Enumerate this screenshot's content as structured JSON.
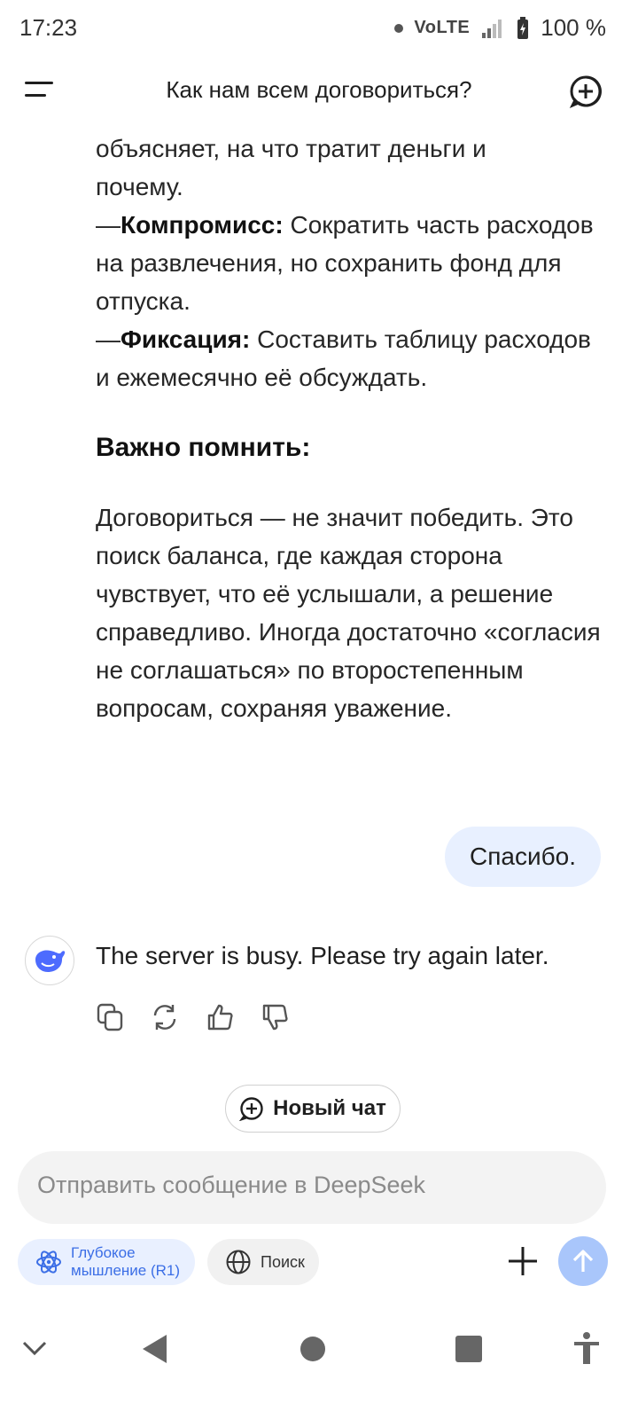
{
  "status_bar": {
    "time": "17:23",
    "network": "VoLTE",
    "battery": "100 %"
  },
  "header": {
    "title": "Как нам всем договориться?"
  },
  "answer": {
    "line1": "объясняет, на что тратит деньги и",
    "line2": "почему.",
    "item_compromise_label": "Компромисс:",
    "item_compromise_text": " Сократить часть расходов на развлечения, но сохранить фонд для отпуска.",
    "item_fix_label": "Фиксация:",
    "item_fix_text": " Составить таблицу расходов и ежемесячно её обсуждать.",
    "dash": "—",
    "important_heading": "Важно помнить:",
    "important_text": "Договориться — не значит победить. Это поиск баланса, где каждая сторона чувствует, что её услышали, а решение справедливо. Иногда достаточно «согласия не соглашаться» по второстепенным вопросам, сохраняя уважение."
  },
  "user_message": "Спасибо.",
  "bot_reply": "The server is busy. Please try again later.",
  "new_chat_label": "Новый чат",
  "composer": {
    "placeholder": "Отправить сообщение в DeepSeek"
  },
  "chips": {
    "deep_think": "Глубокое мышление (R1)",
    "search": "Поиск"
  },
  "colors": {
    "accent": "#3b6ee6",
    "bubble": "#e8f0ff",
    "send": "#a9c6fb"
  },
  "icons": [
    "menu-icon",
    "new-chat-icon",
    "deepseek-logo-icon",
    "copy-icon",
    "regenerate-icon",
    "thumbs-up-icon",
    "thumbs-down-icon",
    "atom-icon",
    "globe-icon",
    "plus-icon",
    "arrow-up-icon",
    "chevron-down-icon",
    "back-icon",
    "home-icon",
    "recents-icon",
    "accessibility-icon"
  ]
}
